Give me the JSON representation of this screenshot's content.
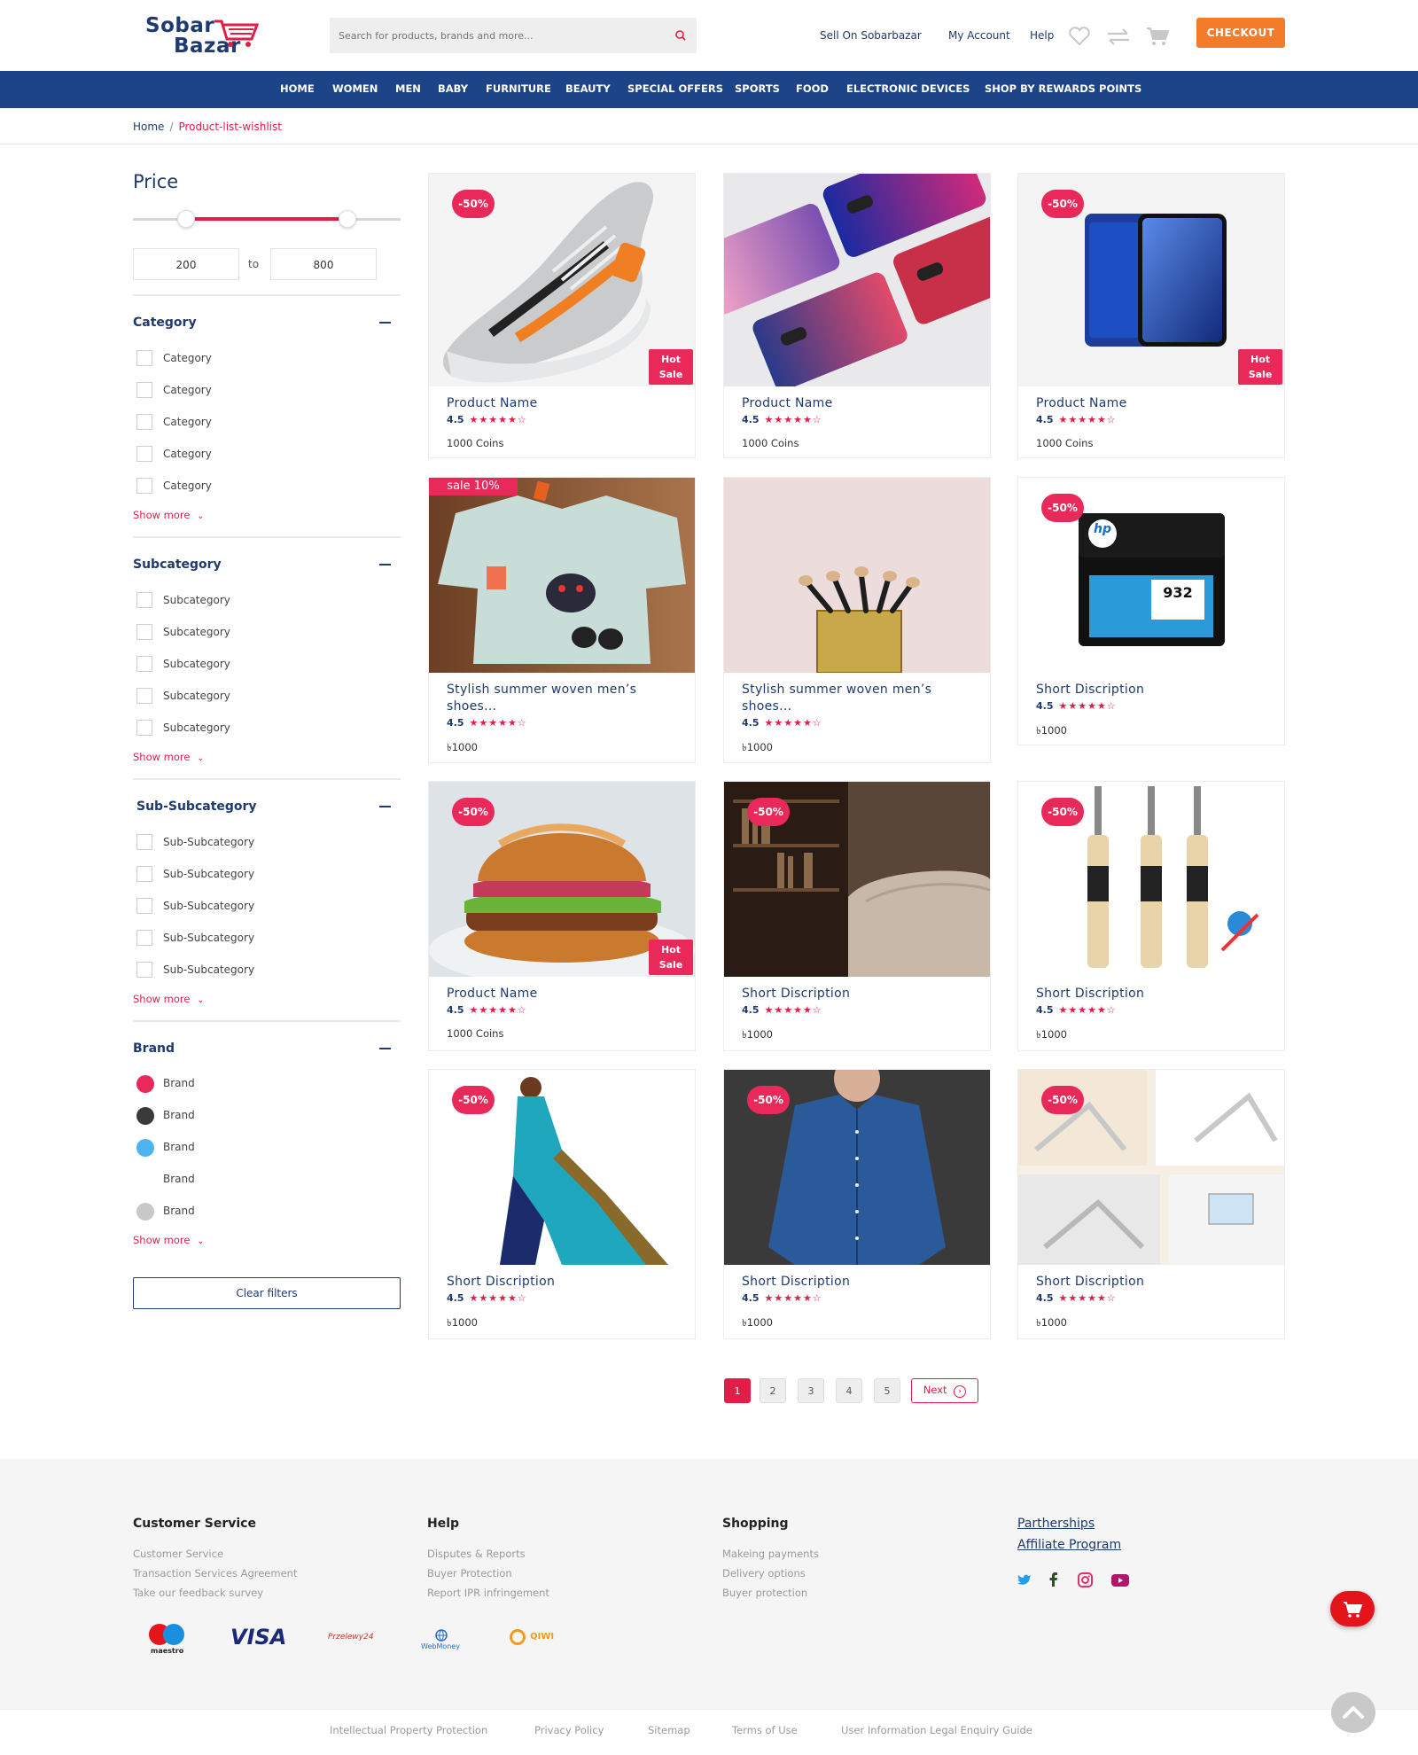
{
  "header": {
    "logo_line1": "Sobar",
    "logo_line2": "Bazar",
    "search_placeholder": "Search for products, brands and more...",
    "links": [
      "Sell On Sobarbazar",
      "My Account",
      "Help"
    ],
    "checkout_label": "CHECKOUT"
  },
  "nav": {
    "items": [
      "HOME",
      "WOMEN",
      "MEN",
      "BABY",
      "FURNITURE",
      "BEAUTY",
      "SPECIAL OFFERS",
      "SPORTS",
      "FOOD",
      "ELECTRONIC DEVICES",
      "SHOP BY REWARDS POINTS"
    ]
  },
  "breadcrumb": {
    "home": "Home",
    "separator": "/",
    "current": "Product-list-wishlist"
  },
  "sidebar": {
    "price_title": "Price",
    "price_min": "200",
    "price_to": "to",
    "price_max": "800",
    "price_range_fraction": [
      0.2,
      0.8
    ],
    "category": {
      "title": "Category",
      "items": [
        "Category",
        "Category",
        "Category",
        "Category",
        "Category"
      ],
      "show_more": "Show more"
    },
    "subcategory": {
      "title": "Subcategory",
      "items": [
        "Subcategory",
        "Subcategory",
        "Subcategory",
        "Subcategory",
        "Subcategory"
      ],
      "show_more": "Show more"
    },
    "subsubcategory": {
      "title": "Sub-Subcategory",
      "items": [
        "Sub-Subcategory",
        "Sub-Subcategory",
        "Sub-Subcategory",
        "Sub-Subcategory",
        "Sub-Subcategory"
      ],
      "show_more": "Show more"
    },
    "brand": {
      "title": "Brand",
      "items": [
        {
          "label": "Brand",
          "color": "#e8295a"
        },
        {
          "label": "Brand",
          "color": "#3a3a3a"
        },
        {
          "label": "Brand",
          "color": "#4fb3f0"
        },
        {
          "label": "Brand",
          "color": "#ffffff"
        },
        {
          "label": "Brand",
          "color": "#c8c8c8"
        }
      ],
      "show_more": "Show more"
    },
    "clear_filters": "Clear filters"
  },
  "products": [
    {
      "title": "Product Name",
      "rating": "4.5",
      "price": "1000 Coins",
      "discount": "-50%",
      "hot": "Hot\nSale",
      "image": "sneaker"
    },
    {
      "title": "Product Name",
      "rating": "4.5",
      "price": "1000 Coins",
      "discount": "",
      "hot": "",
      "image": "phone-cases"
    },
    {
      "title": "Product Name",
      "rating": "4.5",
      "price": "1000 Coins",
      "discount": "-50%",
      "hot": "Hot\nSale",
      "image": "smartphone"
    },
    {
      "title": "Stylish summer woven men’s shoes...",
      "rating": "4.5",
      "price": "৳1000",
      "discount": "",
      "hot": "",
      "sale_tag": "sale 10%",
      "image": "kids-tshirt"
    },
    {
      "title": "Stylish summer woven men’s shoes...",
      "rating": "4.5",
      "price": "৳1000",
      "discount": "",
      "hot": "",
      "image": "makeup-brushes"
    },
    {
      "title": "Short Discription",
      "rating": "4.5",
      "price": "৳1000",
      "discount": "-50%",
      "hot": "",
      "image": "ink-cartridge",
      "cartridge_brand": "hp",
      "cartridge_model": "932"
    },
    {
      "title": "Product Name",
      "rating": "4.5",
      "price": "1000 Coins",
      "discount": "-50%",
      "hot": "Hot\nSale",
      "image": "burger"
    },
    {
      "title": "Short Discription",
      "rating": "4.5",
      "price": "৳1000",
      "discount": "-50%",
      "hot": "",
      "image": "bookshelf-sofa"
    },
    {
      "title": "Short Discription",
      "rating": "4.5",
      "price": "৳1000",
      "discount": "-50%",
      "hot": "",
      "image": "cricket-bats"
    },
    {
      "title": "Short Discription",
      "rating": "4.5",
      "price": "৳1000",
      "discount": "-50%",
      "hot": "",
      "image": "saree"
    },
    {
      "title": "Short Discription",
      "rating": "4.5",
      "price": "৳1000",
      "discount": "-50%",
      "hot": "",
      "image": "denim-shirt"
    },
    {
      "title": "Short Discription",
      "rating": "4.5",
      "price": "৳1000",
      "discount": "-50%",
      "hot": "",
      "image": "laptop-stand"
    }
  ],
  "stars": "★★★★★☆",
  "pagination": {
    "pages": [
      "1",
      "2",
      "3",
      "4",
      "5"
    ],
    "active": "1",
    "next": "Next"
  },
  "footer": {
    "columns": [
      {
        "title": "Customer Service",
        "links": [
          "Customer Service",
          "Transaction Services Agreement",
          "Take our feedback survey"
        ]
      },
      {
        "title": "Help",
        "links": [
          "Disputes & Reports",
          "Buyer Protection",
          "Report IPR infringement"
        ]
      },
      {
        "title": "Shopping",
        "links": [
          "Makeing payments",
          "Delivery options",
          "Buyer protection"
        ]
      }
    ],
    "partner_links": [
      "Partherships",
      "Affiliate Program"
    ],
    "social_icons": [
      "twitter-icon",
      "facebook-icon",
      "instagram-icon",
      "youtube-icon"
    ],
    "payments": [
      "maestro",
      "VISA",
      "Przelewy24",
      "WebMoney",
      "QIWI"
    ],
    "bottom_links": [
      "Intellectual Property Protection",
      "Privacy Policy",
      "Sitemap",
      "Terms of Use",
      "User Information Legal Enquiry Guide"
    ]
  },
  "colors": {
    "brand_blue": "#1d4486",
    "accent_red": "#e11d48",
    "checkout_orange": "#f47b2a"
  }
}
